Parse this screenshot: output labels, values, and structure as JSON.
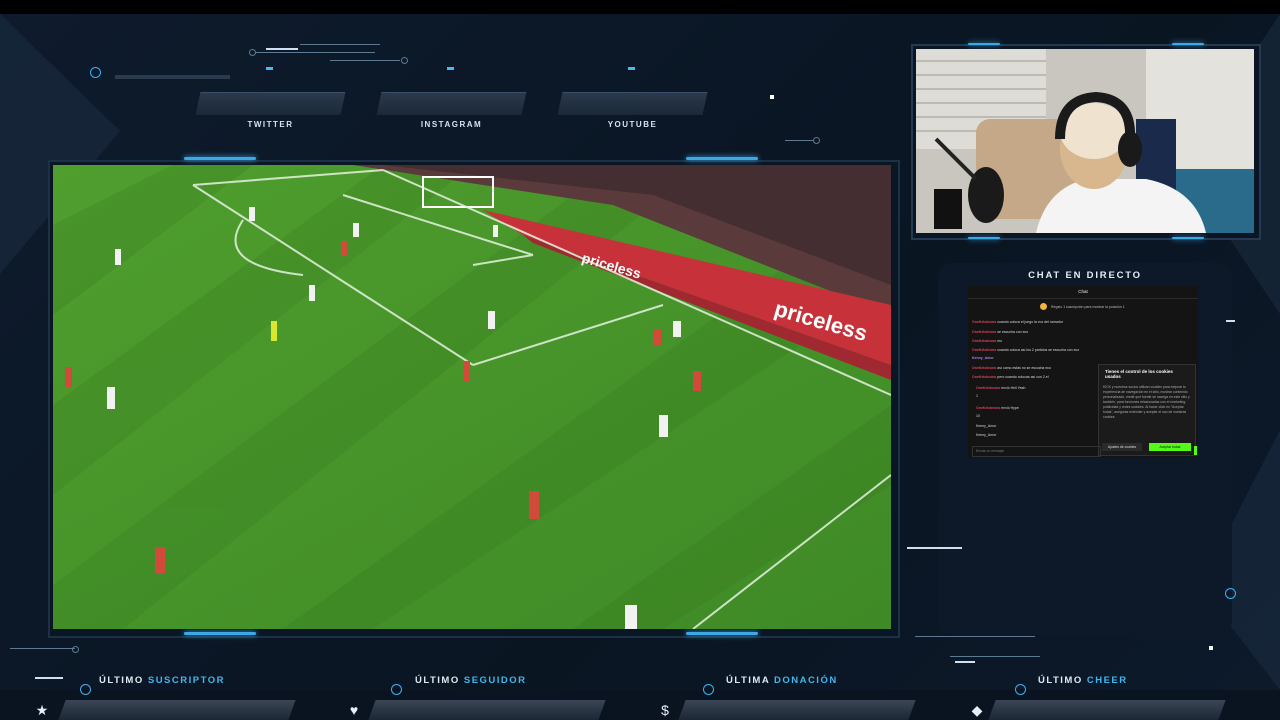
{
  "social": {
    "twitter": "TWITTER",
    "instagram": "INSTAGRAM",
    "youtube": "YOUTUBE"
  },
  "chat": {
    "title": "CHAT EN DIRECTO",
    "tab": "Chat",
    "pinned": "Regalo 1 suscripción para mostrar la posición 1",
    "messages": [
      {
        "user": "OneKelobruno",
        "text": "cuando coloca el juego la voz del narrador"
      },
      {
        "user": "OneKelobruno",
        "text": "se escucha con eco"
      },
      {
        "user": "OneKelobruno",
        "text": "mu"
      },
      {
        "user": "OneKelobruno",
        "text": "cuando coloca así los 2 partidos se escucha con eco"
      },
      {
        "user": "Kenny_Amor",
        "text": ""
      },
      {
        "user": "OneKelobruno",
        "text": "así como estás no se escucha eco"
      },
      {
        "user": "OneKelobruno",
        "text": "pero cuando colocas así con 2 el"
      }
    ],
    "gift1": {
      "user": "OneKelobruno",
      "text": "envió Hell Yeah",
      "count": "1"
    },
    "gift2": {
      "user": "OneKelobruno",
      "text": "envió Hype",
      "count": "10"
    },
    "gift_users": [
      "Kenny_Amor",
      "Kenny_Amor"
    ],
    "cookie": {
      "title": "Tienes el control de los cookies usados",
      "text": "KICK y nuestros socios utilizan cookies para mejorar tu experiencia de navegación en el sitio, mostrar contenido personalizado, medir qué fuente se navega en este sitio y también, para funciones relacionadas con el marketing, publicidad y redes sociales. Al hacer click en \"Aceptar todas\", aseguras entender y aceptar el uso de nuestras cookies.",
      "settings": "Ajustes de cookies",
      "accept": "Aceptar todas"
    },
    "input_placeholder": "Enviar un mensaje"
  },
  "bottom": {
    "sub_prefix": "ÚLTIMO",
    "sub_hl": "SUSCRIPTOR",
    "fol_prefix": "ÚLTIMO",
    "fol_hl": "SEGUIDOR",
    "don_prefix": "ÚLTIMA",
    "don_hl": "DONACIÓN",
    "cheer_prefix": "ÚLTIMO",
    "cheer_hl": "CHEER",
    "icons": [
      "star-icon",
      "heart-icon",
      "dollar-icon",
      "gem-icon"
    ]
  },
  "video": {
    "ad_boards": [
      "priceless",
      "priceless"
    ]
  },
  "colors": {
    "accent": "#3aa9e6",
    "chat_user": "#e0425a",
    "kick_green": "#53fc18"
  }
}
